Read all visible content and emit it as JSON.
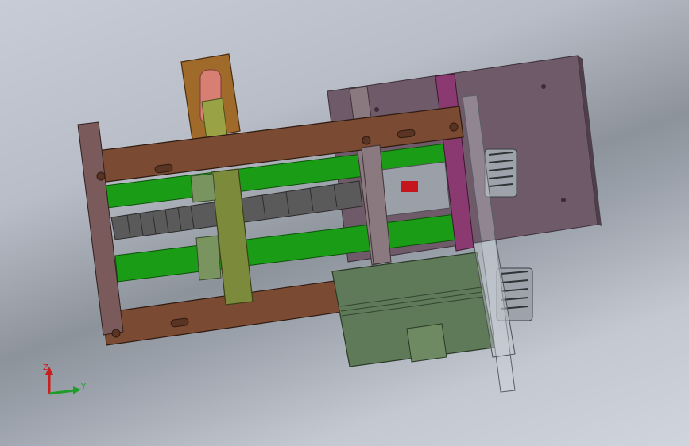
{
  "viewport": {
    "background_top": "#c7ccd6",
    "background_band": "#8d939b"
  },
  "axes": {
    "z_label": "Z",
    "y_label": "Y",
    "z_color": "#c81e1e",
    "y_color": "#1e9e28"
  },
  "colors": {
    "frame": "#7a4a32",
    "rod": "#1b9c16",
    "screw": "#4a4a4a",
    "motor": "#5e7a58",
    "plate": "#6e5a68",
    "carriage": "#7c8a3c",
    "column": "#a06a2a",
    "bar_magenta": "#8a3a70"
  }
}
